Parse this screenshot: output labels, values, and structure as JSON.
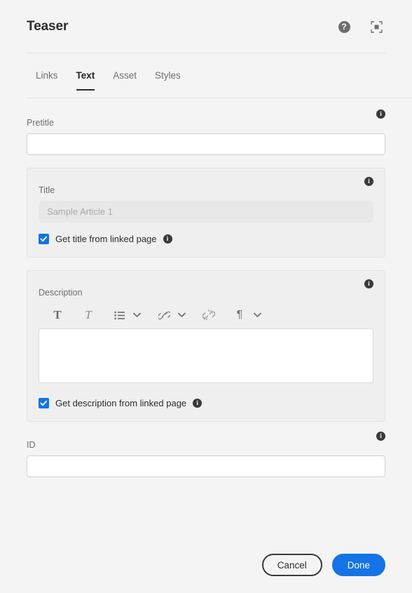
{
  "header": {
    "title": "Teaser",
    "help_icon": "help-circle-icon",
    "help_glyph": "?",
    "fullscreen_icon": "fullscreen-icon"
  },
  "tabs": [
    {
      "label": "Links",
      "active": false
    },
    {
      "label": "Text",
      "active": true
    },
    {
      "label": "Asset",
      "active": false
    },
    {
      "label": "Styles",
      "active": false
    }
  ],
  "fields": {
    "pretitle": {
      "label": "Pretitle",
      "value": "",
      "placeholder": "",
      "info_glyph": "i"
    },
    "title": {
      "label": "Title",
      "value": "Sample Article 1",
      "placeholder": "Sample Article 1",
      "disabled": true,
      "info_glyph": "i",
      "checkbox": {
        "label": "Get title from linked page",
        "checked": true,
        "info_glyph": "i"
      }
    },
    "description": {
      "label": "Description",
      "value": "",
      "placeholder": "",
      "info_glyph": "i",
      "checkbox": {
        "label": "Get description from linked page",
        "checked": true,
        "info_glyph": "i"
      },
      "toolbar": [
        {
          "name": "bold-icon",
          "glyph": "T"
        },
        {
          "name": "italic-icon",
          "glyph": "T"
        },
        {
          "name": "bulleted-list-icon",
          "glyph": ""
        },
        {
          "name": "list-options-chevron-down-icon",
          "glyph": ""
        },
        {
          "name": "link-icon",
          "glyph": ""
        },
        {
          "name": "link-options-chevron-down-icon",
          "glyph": ""
        },
        {
          "name": "unlink-icon",
          "glyph": ""
        },
        {
          "name": "paragraph-icon",
          "glyph": "¶"
        },
        {
          "name": "paragraph-options-chevron-down-icon",
          "glyph": ""
        }
      ]
    },
    "id": {
      "label": "ID",
      "value": "",
      "placeholder": "",
      "info_glyph": "i"
    }
  },
  "footer": {
    "cancel_label": "Cancel",
    "done_label": "Done"
  },
  "colors": {
    "accent": "#1473E6",
    "page_bg": "#F4F4F4",
    "panel_bg": "#EFEFEF",
    "text": "#2C2C2C",
    "muted_text": "#6E6E6E"
  }
}
